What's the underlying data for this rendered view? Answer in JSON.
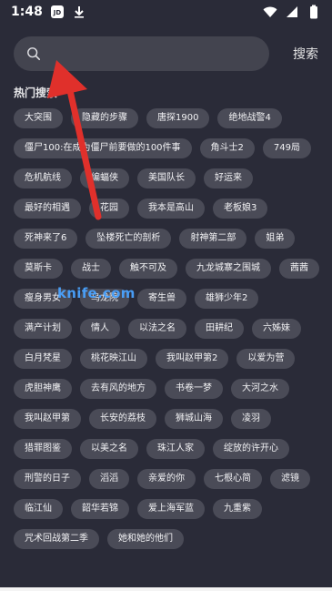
{
  "status_bar": {
    "time": "1:48",
    "notification_badge": "JD",
    "icons": [
      "jd-app-icon",
      "download-icon",
      "wifi-icon",
      "signal-icon",
      "battery-icon"
    ]
  },
  "search": {
    "placeholder": "",
    "button_label": "搜索"
  },
  "hot_search": {
    "title": "热门搜索",
    "tags": [
      "大突围",
      "隐藏的步骤",
      "唐探1900",
      "绝地战警4",
      "僵尸100:在成为僵尸前要做的100件事",
      "角斗士2",
      "749局",
      "危机航线",
      "编蝠侠",
      "美国队长",
      "好运来",
      "最好的相遇",
      "花园",
      "我本是高山",
      "老板娘3",
      "死神来了6",
      "坠楼死亡的剖析",
      "射神第二部",
      "姐弟",
      "莫斯卡",
      "战士",
      "触不可及",
      "九龙城寨之围城",
      "茜茜",
      "瘦身男女",
      "乌龙院",
      "寄生兽",
      "雄狮少年2",
      "满产计划",
      "情人",
      "以法之名",
      "田耕纪",
      "六姊妹",
      "白月梵星",
      "桃花映江山",
      "我叫赵甲第2",
      "以爱为营",
      "虎胆神鹰",
      "去有风的地方",
      "书卷一梦",
      "大河之水",
      "我叫赵甲第",
      "长安的荔枝",
      "狮城山海",
      "凌羽",
      "猎罪图鉴",
      "以美之名",
      "珠江人家",
      "绽放的许开心",
      "刑警的日子",
      "滔滔",
      "亲爱的你",
      "七根心简",
      "滤镜",
      "临江仙",
      "韶华若锦",
      "爱上海军蓝",
      "九重紫",
      "咒术回战第二季",
      "她和她的他们"
    ]
  },
  "overlay": {
    "watermark_text": "knife.com",
    "arrow_color": "#e0302b",
    "watermark_color": "#4aa3ff"
  },
  "colors": {
    "background": "#2a2b38",
    "search_box": "#43444f",
    "tag_background": "#4a4b57",
    "text": "#ffffff"
  }
}
